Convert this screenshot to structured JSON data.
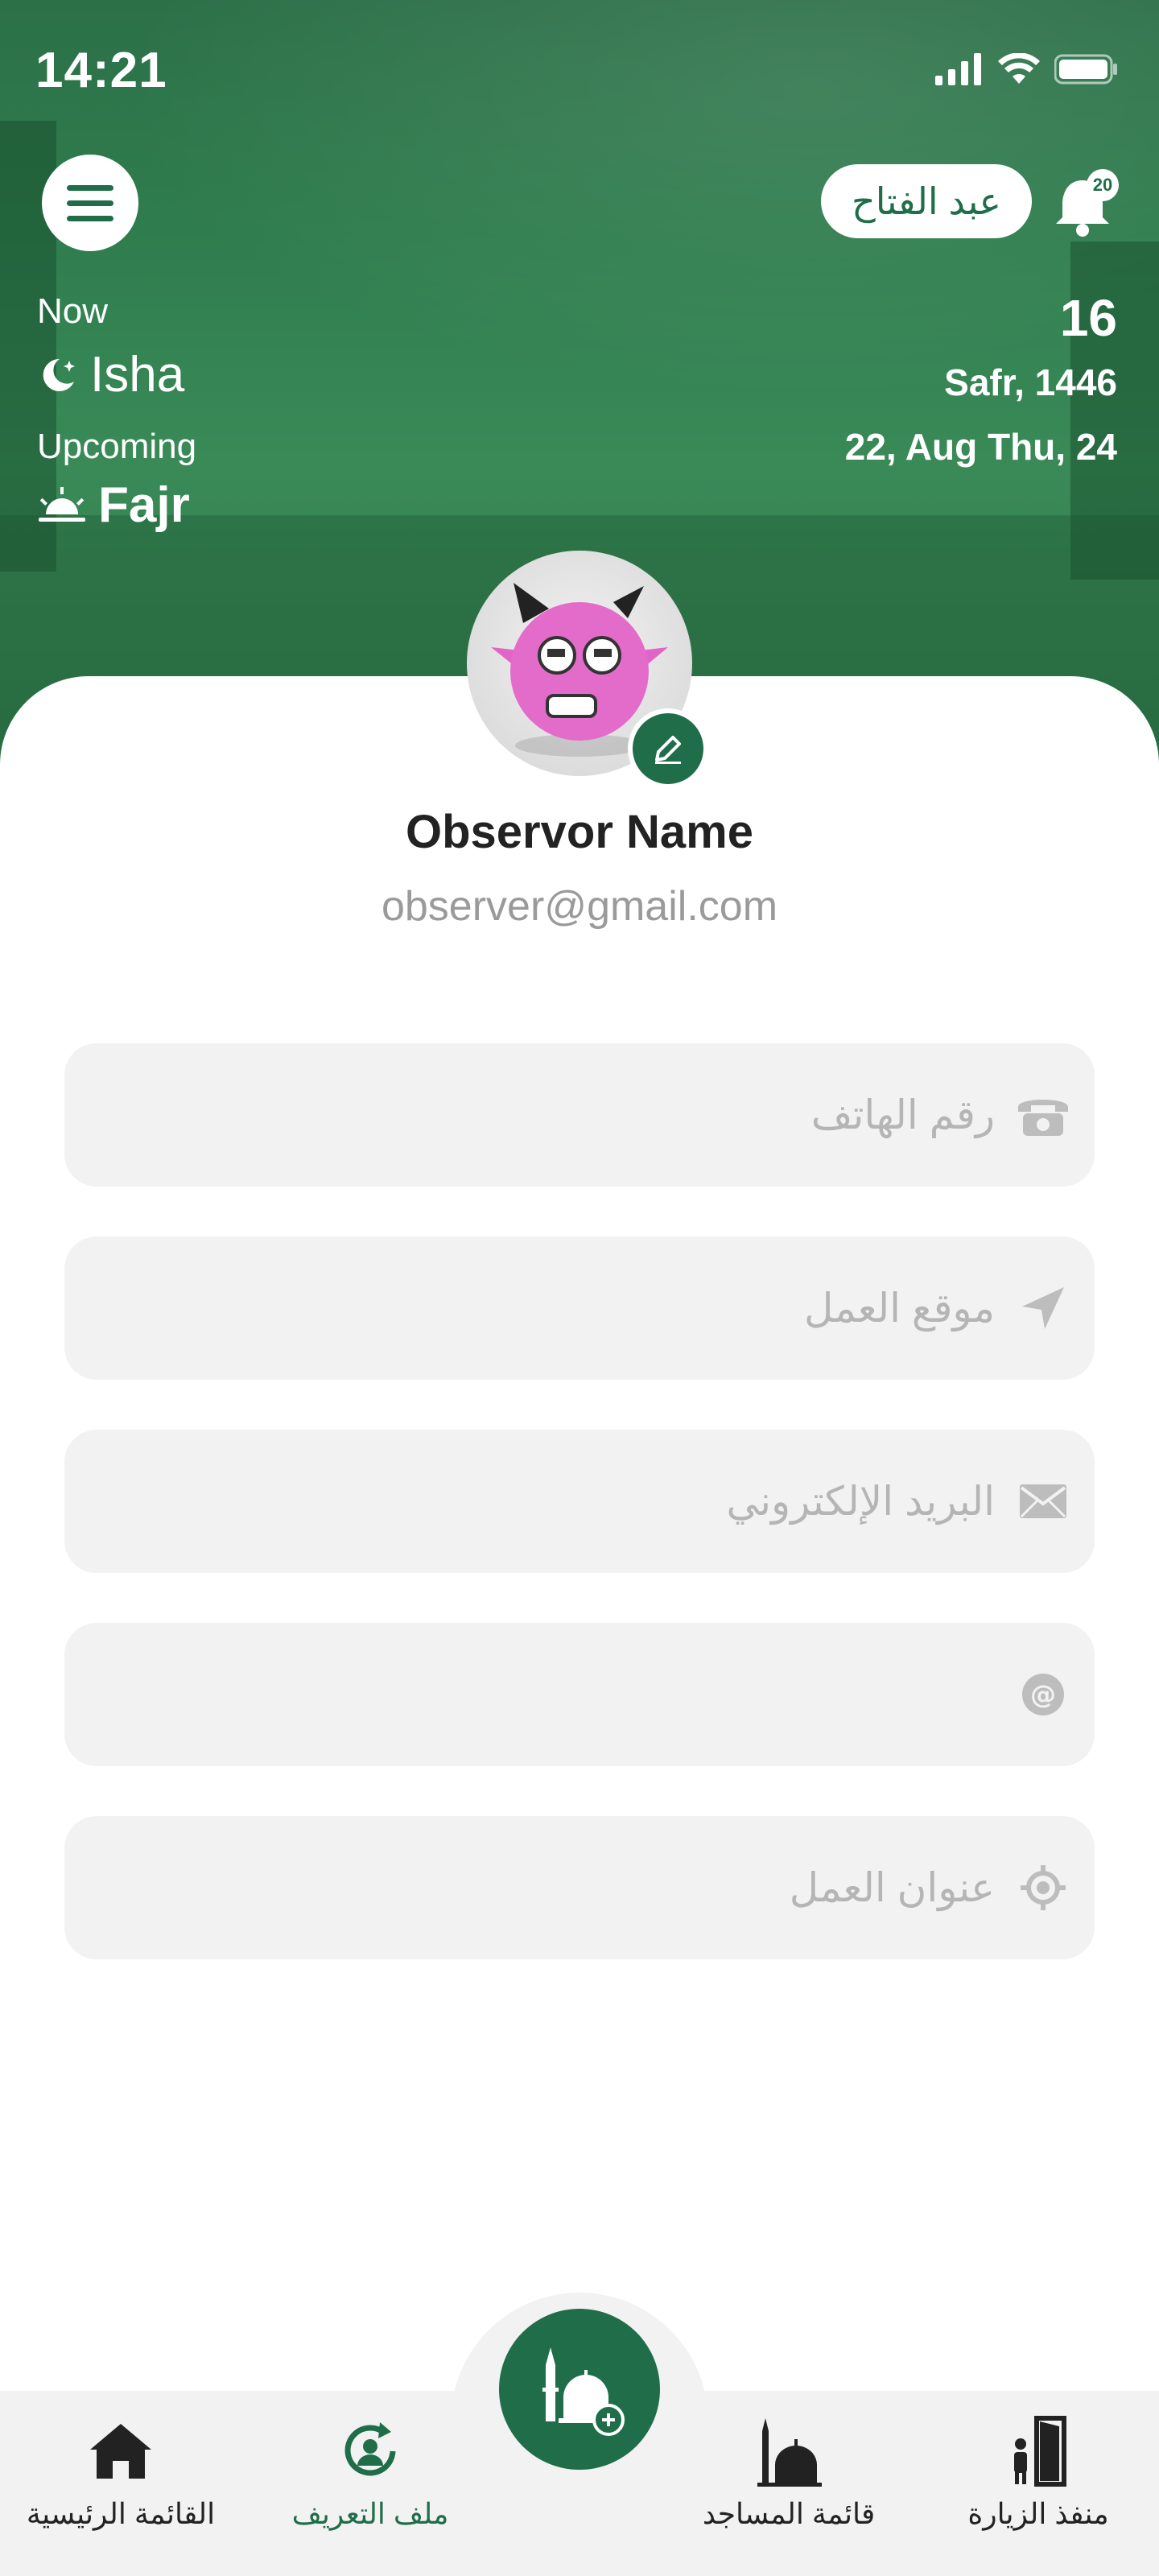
{
  "status_bar": {
    "time": "14:21"
  },
  "header": {
    "user_name": "عبد الفتاح",
    "notification_count": "20",
    "prayer": {
      "now_label": "Now",
      "now_name": "Isha",
      "upcoming_label": "Upcoming",
      "upcoming_name": "Fajr"
    },
    "date": {
      "hijri_day": "16",
      "hijri_month_year": "Safr, 1446",
      "gregorian": "22, Aug Thu, 24"
    }
  },
  "profile": {
    "name": "Observor Name",
    "email": "observer@gmail.com"
  },
  "fields": [
    {
      "icon": "phone-icon",
      "placeholder": "رقم الهاتف"
    },
    {
      "icon": "location-arrow-icon",
      "placeholder": "موقع العمل"
    },
    {
      "icon": "mail-icon",
      "placeholder": "البريد الإلكتروني"
    },
    {
      "icon": "at-icon",
      "placeholder": ""
    },
    {
      "icon": "target-icon",
      "placeholder": "عنوان العمل"
    }
  ],
  "bottom_nav": {
    "items": [
      {
        "label": "القائمة الرئيسية",
        "icon": "home-icon"
      },
      {
        "label": "ملف التعريف",
        "icon": "profile-refresh-icon"
      },
      {
        "label": "قائمة المساجد",
        "icon": "mosque-icon"
      },
      {
        "label": "منفذ الزيارة",
        "icon": "visit-door-icon"
      }
    ],
    "fab_icon": "add-mosque-icon"
  },
  "colors": {
    "primary": "#1f6e49",
    "field_bg": "#f3f2f3",
    "placeholder": "#b5b5b5"
  }
}
